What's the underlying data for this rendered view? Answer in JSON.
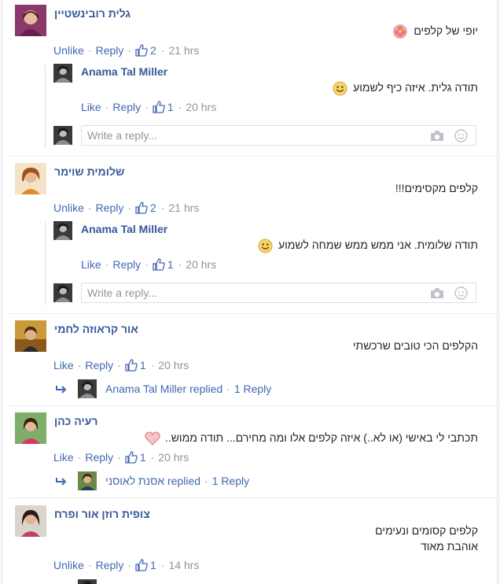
{
  "comments": [
    {
      "author": "גלית רובינשטיין",
      "text": "יופי של קלפים",
      "actions": {
        "like": "Unlike",
        "reply": "Reply",
        "count": "2",
        "time": "21 hrs"
      },
      "reply": {
        "author": "Anama Tal Miller",
        "text": "תודה גלית. איזה כיף לשמוע",
        "actions": {
          "like": "Like",
          "reply": "Reply",
          "count": "1",
          "time": "20 hrs"
        }
      },
      "input_placeholder": "Write a reply..."
    },
    {
      "author": "שלומית שוימר",
      "text": "קלפים מקסימים!!!",
      "actions": {
        "like": "Unlike",
        "reply": "Reply",
        "count": "2",
        "time": "21 hrs"
      },
      "reply": {
        "author": "Anama Tal Miller",
        "text": "תודה שלומית. אני ממש ממש שמחה לשמוע",
        "actions": {
          "like": "Like",
          "reply": "Reply",
          "count": "1",
          "time": "20 hrs"
        }
      },
      "input_placeholder": "Write a reply..."
    },
    {
      "author": "אור קראוזה לחמי",
      "text": "הקלפים הכי טובים שרכשתי",
      "actions": {
        "like": "Like",
        "reply": "Reply",
        "count": "1",
        "time": "20 hrs"
      },
      "replied": {
        "name": "Anama Tal Miller",
        "suffix": "replied",
        "count": "1 Reply"
      }
    },
    {
      "author": "רעיה כהן",
      "text": "תכתבי לי באישי (או לא..) איזה קלפים אלו ומה מחירם... תודה ממוש..",
      "actions": {
        "like": "Like",
        "reply": "Reply",
        "count": "1",
        "time": "20 hrs"
      },
      "replied": {
        "name": "אסנת לאוסני",
        "suffix": "replied",
        "count": "1 Reply"
      }
    },
    {
      "author": "צופית רוזן אור ופרח",
      "text_lines": [
        "קלפים קסומים ונעימים",
        "אוהבת מאוד"
      ],
      "actions": {
        "like": "Unlike",
        "reply": "Reply",
        "count": "1",
        "time": "14 hrs"
      }
    }
  ],
  "colors": {
    "link": "#4267b2",
    "author": "#365899",
    "meta": "#90949c",
    "text": "#1d2129"
  }
}
